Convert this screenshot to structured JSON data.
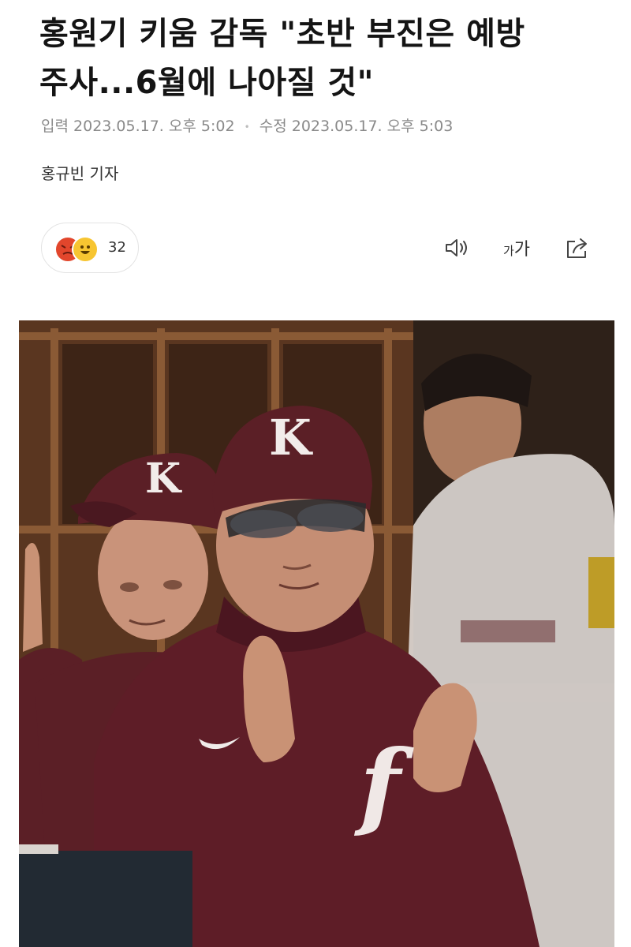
{
  "article": {
    "headline_line1": "홍원기 키움 감독 \"초반 부진은 예방",
    "headline_line2": "주사...6월에 나아질 것\"",
    "published_label": "입력",
    "published_time": "2023.05.17. 오후 5:02",
    "modified_label": "수정",
    "modified_time": "2023.05.17. 오후 5:03",
    "reporter": "홍규빈 기자"
  },
  "reactions": {
    "count": "32",
    "icons": [
      "angry-face-icon",
      "happy-face-icon"
    ]
  },
  "toolbar": {
    "speaker_icon": "speaker-icon",
    "font_size_small": "가",
    "font_size_large": "가",
    "share_icon": "share-icon"
  },
  "photo": {
    "cap_logo_1": "K",
    "cap_logo_2": "K",
    "hoodie_logo": "f",
    "colors": {
      "burgundy": "#5b1f26",
      "dugout_wood": "#6a3d24"
    }
  }
}
